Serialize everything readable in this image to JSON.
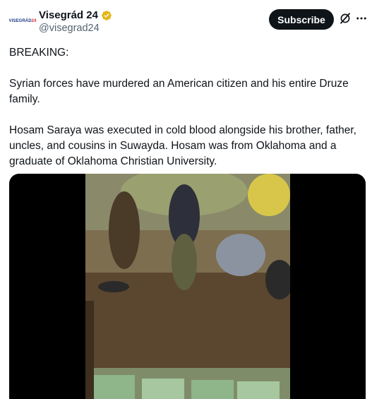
{
  "author": {
    "display_name": "Visegrád 24",
    "handle": "@visegrad24",
    "avatar_text": [
      "VISEGRÁD",
      "24"
    ],
    "verified_color": "#e2b719"
  },
  "actions": {
    "subscribe_label": "Subscribe",
    "grok_icon": "grok-icon",
    "more_icon": "more-icon"
  },
  "tweet": {
    "paragraphs": [
      "BREAKING:",
      "Syrian forces have murdered an American citizen and his entire Druze family.",
      "Hosam Saraya was executed in cold blood alongside his brother, father, uncles, and cousins in Suwayda. Hosam was from Oklahoma and a graduate of Oklahoma Christian University."
    ]
  },
  "media": {
    "type": "video",
    "background": "#000000"
  }
}
